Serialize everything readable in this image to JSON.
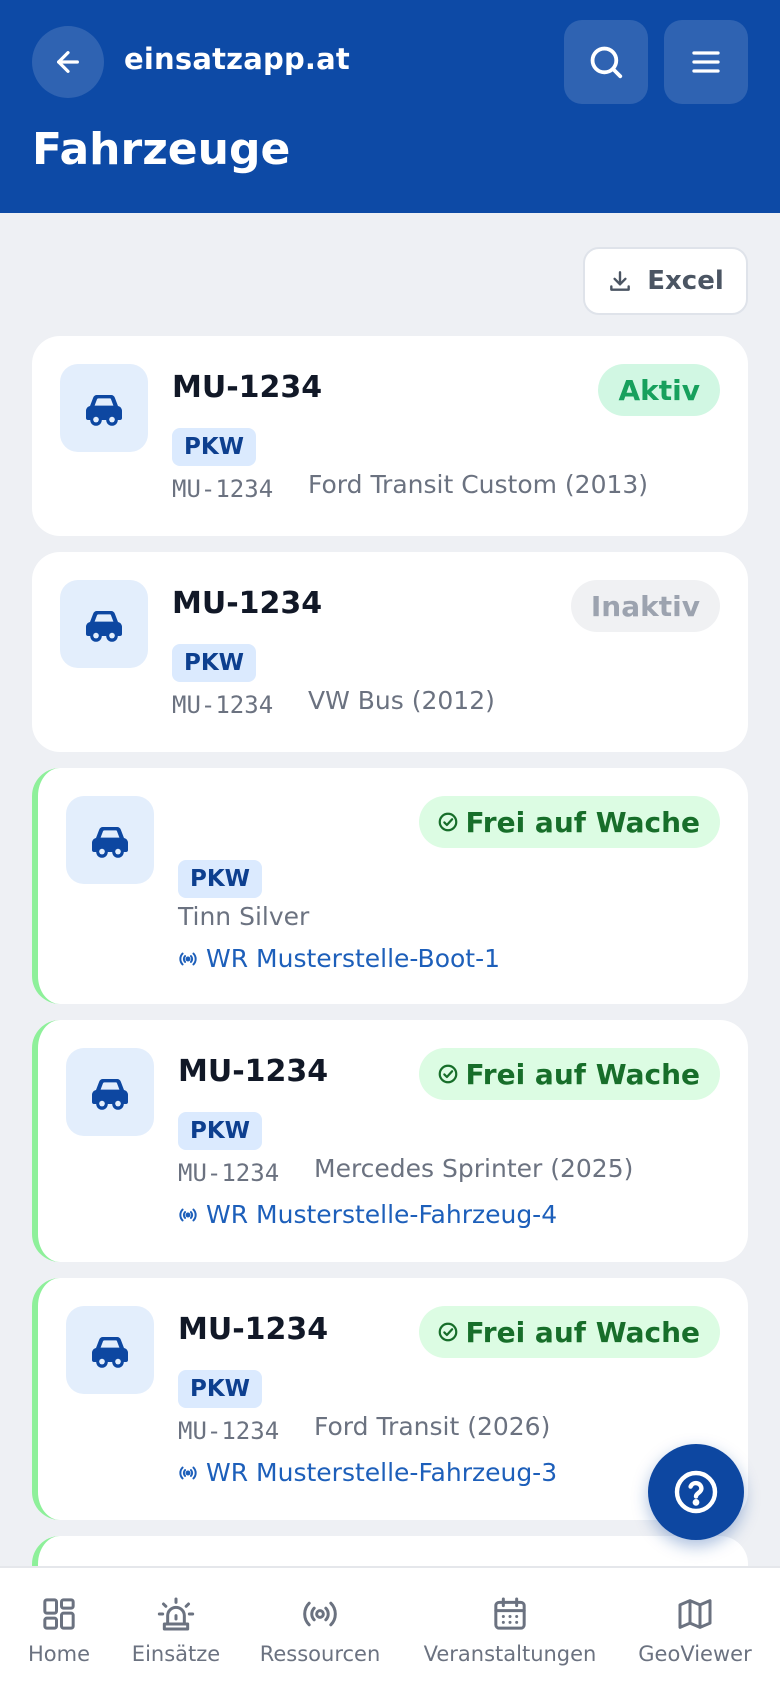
{
  "header": {
    "site_name": "einsatzapp.at",
    "page_title": "Fahrzeuge",
    "color": "#0d4aa6"
  },
  "toolbar": {
    "excel_label": "Excel"
  },
  "vehicles": [
    {
      "plate": "MU-1234",
      "type": "PKW",
      "plate_code": "MU-1234",
      "model": "Ford Transit Custom (2013)",
      "status": "Aktiv"
    },
    {
      "plate": "MU-1234",
      "type": "PKW",
      "plate_code": "MU-1234",
      "model": "VW Bus (2012)",
      "status": "Inaktiv"
    },
    {
      "type": "PKW",
      "model": "Tinn Silver",
      "station": "WR Musterstelle-Boot-1",
      "status": "Frei auf Wache"
    },
    {
      "plate": "MU-1234",
      "type": "PKW",
      "plate_code": "MU-1234",
      "model": "Mercedes Sprinter (2025)",
      "station": "WR Musterstelle-Fahrzeug-4",
      "status": "Frei auf Wache"
    },
    {
      "plate": "MU-1234",
      "type": "PKW",
      "plate_code": "MU-1234",
      "model": "Ford Transit (2026)",
      "station": "WR Musterstelle-Fahrzeug-3",
      "status": "Frei auf Wache"
    }
  ],
  "nav": {
    "items": [
      {
        "label": "Home",
        "icon": "home-grid-icon"
      },
      {
        "label": "Einsätze",
        "icon": "siren-icon"
      },
      {
        "label": "Ressourcen",
        "icon": "broadcast-icon"
      },
      {
        "label": "Veranstaltungen",
        "icon": "calendar-icon"
      },
      {
        "label": "GeoViewer",
        "icon": "map-icon"
      }
    ]
  },
  "colors": {
    "aktiv": "#17a05d",
    "inaktiv": "#9ca3af",
    "frei": "#176e2a",
    "accent": "#0d47a1"
  }
}
